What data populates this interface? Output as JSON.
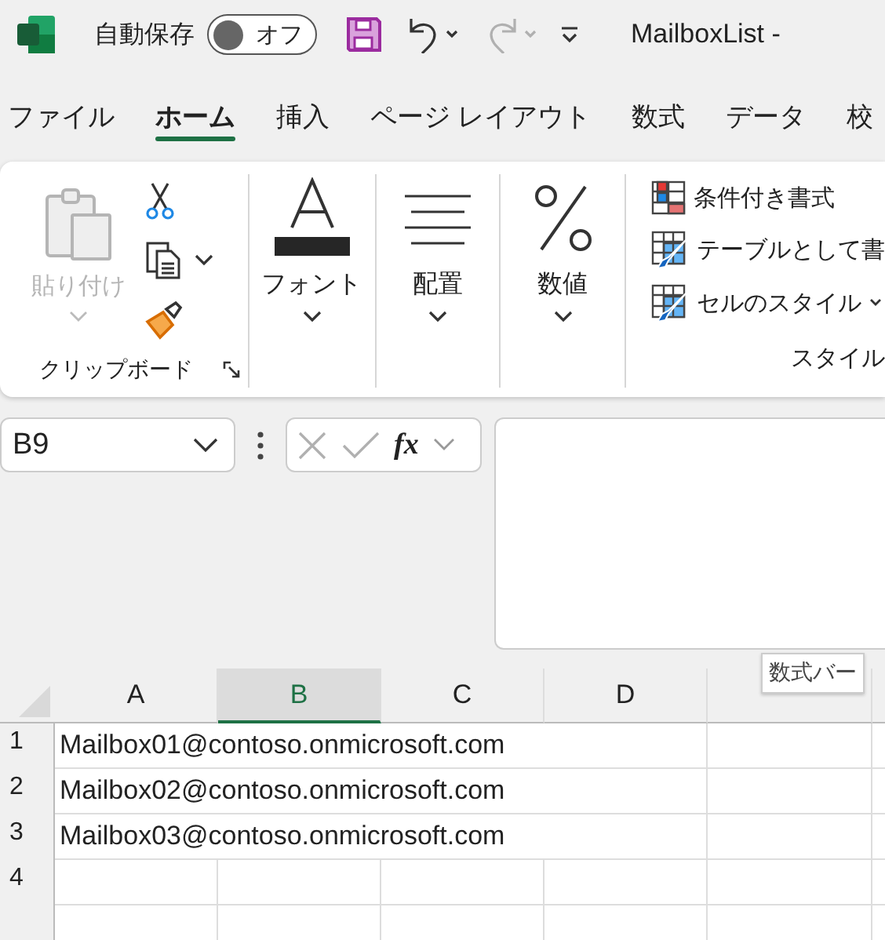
{
  "title_bar": {
    "autosave_label": "自動保存",
    "autosave": {
      "label": "オフ",
      "on": false
    },
    "undo_disabled": false,
    "redo_disabled": true,
    "title": "MailboxList -"
  },
  "tabs": [
    {
      "label": "ファイル",
      "selected": false
    },
    {
      "label": "ホーム",
      "selected": true
    },
    {
      "label": "挿入",
      "selected": false
    },
    {
      "label": "ページ レイアウト",
      "selected": false
    },
    {
      "label": "数式",
      "selected": false
    },
    {
      "label": "データ",
      "selected": false
    },
    {
      "label": "校",
      "selected": false
    }
  ],
  "ribbon": {
    "groups": [
      {
        "kind": "clipboard",
        "paste": {
          "label": "貼り付け",
          "disabled": true
        },
        "label": "クリップボード"
      },
      {
        "kind": "dropdown",
        "label": "フォント"
      },
      {
        "kind": "dropdown",
        "label": "配置"
      },
      {
        "kind": "dropdown",
        "label": "数値"
      },
      {
        "kind": "styles",
        "items": [
          {
            "label": "条件付き書式"
          },
          {
            "label": "テーブルとして書"
          },
          {
            "label": "セルのスタイル"
          }
        ],
        "label": "スタイル"
      }
    ]
  },
  "formula_bar": {
    "name_box": "B9",
    "cancel_disabled": true,
    "enter_disabled": true,
    "function_label": "fx",
    "tooltip": "数式バー"
  },
  "sheet": {
    "columns": [
      {
        "label": "A",
        "selected": false
      },
      {
        "label": "B",
        "selected": true
      },
      {
        "label": "C",
        "selected": false
      },
      {
        "label": "D",
        "selected": false
      }
    ],
    "rows": [
      {
        "label": "1",
        "value": "Mailbox01@contoso.onmicrosoft.com"
      },
      {
        "label": "2",
        "value": "Mailbox02@contoso.onmicrosoft.com"
      },
      {
        "label": "3",
        "value": "Mailbox03@contoso.onmicrosoft.com"
      },
      {
        "label": "4"
      }
    ]
  }
}
